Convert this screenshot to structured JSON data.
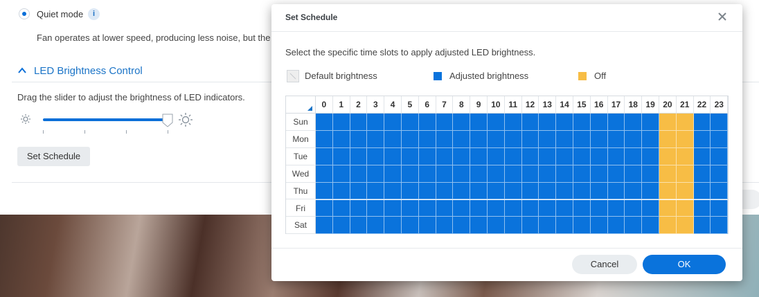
{
  "background_page": {
    "quiet_mode_label": "Quiet mode",
    "info_icon": "i",
    "fan_description": "Fan operates at lower speed, producing less noise, but the",
    "section_title": "LED Brightness Control",
    "slider_instruction": "Drag the slider to adjust the brightness of LED indicators.",
    "slider_level_fraction": 1.0,
    "set_schedule_button": "Set Schedule"
  },
  "dialog": {
    "title": "Set Schedule",
    "instruction": "Select the specific time slots to apply adjusted LED brightness.",
    "legend": [
      {
        "label": "Default brightness",
        "color": "#eeeeee"
      },
      {
        "label": "Adjusted brightness",
        "color": "#0a73dc"
      },
      {
        "label": "Off",
        "color": "#f7bd45"
      }
    ],
    "hours": [
      "0",
      "1",
      "2",
      "3",
      "4",
      "5",
      "6",
      "7",
      "8",
      "9",
      "10",
      "11",
      "12",
      "13",
      "14",
      "15",
      "16",
      "17",
      "18",
      "19",
      "20",
      "21",
      "22",
      "23"
    ],
    "days": [
      "Sun",
      "Mon",
      "Tue",
      "Wed",
      "Thu",
      "Fri",
      "Sat"
    ],
    "schedule": {
      "adjusted_hours": [
        0,
        1,
        2,
        3,
        4,
        5,
        6,
        7,
        8,
        9,
        10,
        11,
        12,
        13,
        14,
        15,
        16,
        17,
        18,
        19,
        22,
        23
      ],
      "off_hours": [
        20,
        21
      ]
    },
    "cancel_label": "Cancel",
    "ok_label": "OK"
  },
  "colors": {
    "accent": "#0a73dc",
    "adjusted": "#0a73dc",
    "off": "#f7bd45",
    "default": "#eeeeee"
  }
}
